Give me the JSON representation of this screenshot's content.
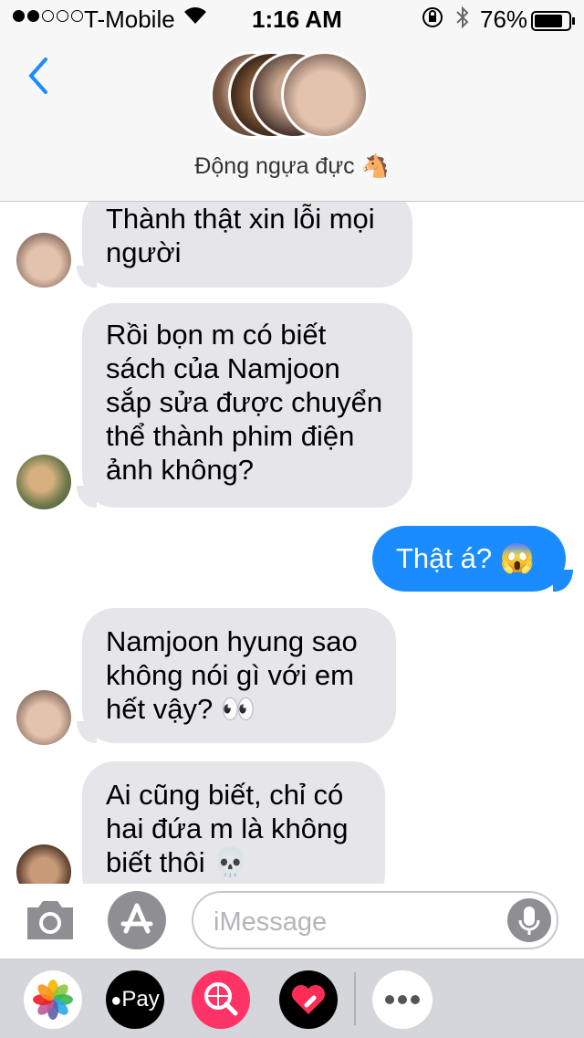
{
  "status": {
    "carrier": "T-Mobile",
    "time": "1:16 AM",
    "battery": "76%"
  },
  "header": {
    "group_name": "Động ngựa đực 🐴"
  },
  "messages": [
    {
      "side": "left",
      "lines": [
        "Thành thật xin lỗi mọi",
        "người"
      ]
    },
    {
      "side": "left",
      "lines": [
        "Rồi bọn m có biết",
        "sách của Namjoon",
        "sắp sửa được chuyển",
        "thể thành phim điện",
        "ảnh không?"
      ]
    },
    {
      "side": "right",
      "lines": [
        "Thật á? 😱"
      ]
    },
    {
      "side": "left",
      "lines": [
        "Namjoon hyung sao",
        "không nói gì với em",
        "hết vậy? 👀"
      ]
    },
    {
      "side": "left",
      "lines": [
        "Ai cũng biết, chỉ có",
        "hai đứa m là không",
        "biết thôi 💀"
      ]
    }
  ],
  "input": {
    "placeholder": "iMessage"
  },
  "drawer": {
    "apple_pay": "Pay"
  },
  "icons": {
    "back": "chevron-left-icon",
    "camera": "camera-icon",
    "appstore": "app-store-icon",
    "mic": "microphone-icon"
  },
  "colors": {
    "accent": "#1a8cff",
    "bubble_gray": "#e5e5ea"
  }
}
